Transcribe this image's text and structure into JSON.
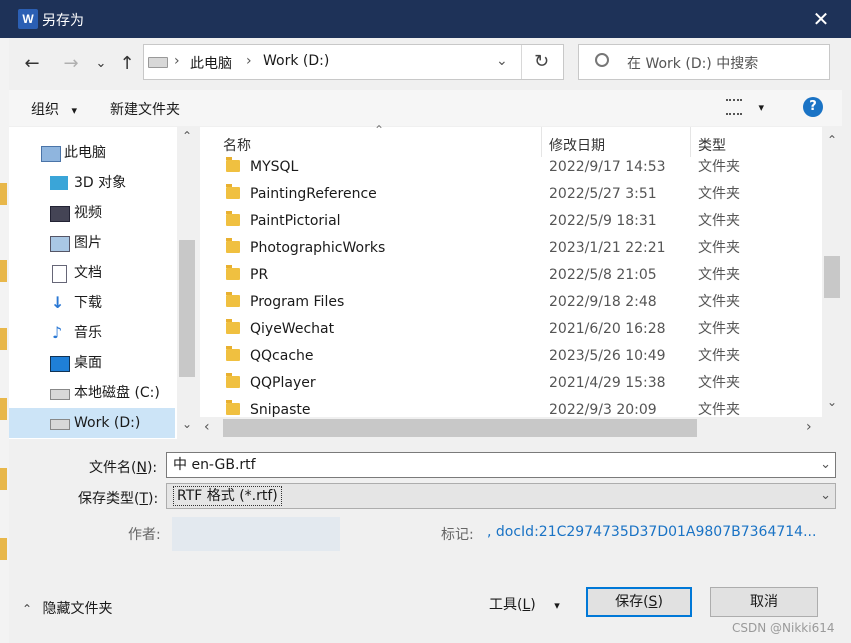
{
  "window": {
    "app_icon": "W",
    "title": "另存为",
    "close": "✕"
  },
  "nav": {
    "back": "←",
    "forward": "→",
    "recent": "⌄",
    "up": "↑",
    "path": [
      "此电脑",
      "Work (D:)"
    ],
    "refresh": "↻",
    "search_placeholder": "在 Work (D:) 中搜索"
  },
  "toolbar": {
    "organize": "组织",
    "organize_caret": "▾",
    "new_folder": "新建文件夹",
    "view_caret": "▾",
    "help": "?"
  },
  "sidebar": {
    "items": [
      {
        "label": "此电脑",
        "icon": "computer-icon"
      },
      {
        "label": "3D 对象",
        "icon": "cube-icon"
      },
      {
        "label": "视频",
        "icon": "video-icon"
      },
      {
        "label": "图片",
        "icon": "picture-icon"
      },
      {
        "label": "文档",
        "icon": "document-icon"
      },
      {
        "label": "下载",
        "icon": "download-icon"
      },
      {
        "label": "音乐",
        "icon": "music-icon"
      },
      {
        "label": "桌面",
        "icon": "desktop-icon"
      },
      {
        "label": "本地磁盘 (C:)",
        "icon": "drive-icon"
      },
      {
        "label": "Work (D:)",
        "icon": "drive-icon"
      }
    ]
  },
  "columns": {
    "name": "名称",
    "date": "修改日期",
    "type": "类型"
  },
  "files": [
    {
      "name": "MYSQL",
      "date": "2022/9/17 14:53",
      "type": "文件夹"
    },
    {
      "name": "PaintingReference",
      "date": "2022/5/27 3:51",
      "type": "文件夹"
    },
    {
      "name": "PaintPictorial",
      "date": "2022/5/9 18:31",
      "type": "文件夹"
    },
    {
      "name": "PhotographicWorks",
      "date": "2023/1/21 22:21",
      "type": "文件夹"
    },
    {
      "name": "PR",
      "date": "2022/5/8 21:05",
      "type": "文件夹"
    },
    {
      "name": "Program Files",
      "date": "2022/9/18 2:48",
      "type": "文件夹"
    },
    {
      "name": "QiyeWechat",
      "date": "2021/6/20 16:28",
      "type": "文件夹"
    },
    {
      "name": "QQcache",
      "date": "2023/5/26 10:49",
      "type": "文件夹"
    },
    {
      "name": "QQPlayer",
      "date": "2021/4/29 15:38",
      "type": "文件夹"
    },
    {
      "name": "Snipaste",
      "date": "2022/9/3 20:09",
      "type": "文件夹"
    }
  ],
  "form": {
    "filename_label": "文件名(",
    "filename_key": "N",
    "filename_close": "):",
    "filename_value": "中 en-GB.rtf",
    "type_label": "保存类型(",
    "type_key": "T",
    "type_close": "):",
    "type_value": "RTF 格式 (*.rtf)",
    "author_label": "作者:",
    "tags_label": "标记:",
    "tags_value": ", docId:21C2974735D37D01A9807B7364714..."
  },
  "footer": {
    "hide_folders": "隐藏文件夹",
    "tools": "工具(",
    "tools_key": "L",
    "tools_close": ")",
    "save": "保存(",
    "save_key": "S",
    "save_close": ")",
    "cancel": "取消",
    "watermark": "CSDN @Nikki614"
  },
  "colors": {
    "titlebar": "#1e3258",
    "accent": "#1a73c5",
    "selection": "#cce4f7",
    "folder": "#f0c040"
  }
}
